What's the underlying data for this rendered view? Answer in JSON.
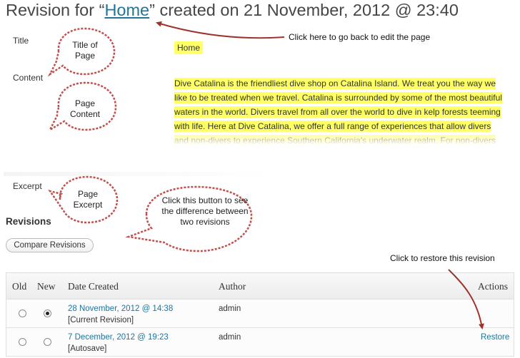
{
  "header": {
    "prefix": "Revision for “",
    "link_text": "Home",
    "suffix": "” created on 21 November, 2012 @ 23:40"
  },
  "fields": {
    "title_label": "Title",
    "title_value": "Home",
    "content_label": "Content",
    "content_value": "Dive Catalina is the friendliest dive shop on Catalina Island. We treat you the way we like to be treated when we travel. Catalina is surrounded by some of the most beautiful waters in the world. Divers travel from all over the world to dive in kelp forests teeming with life. Here at Dive Catalina, we offer a full range of experiences that allow divers and non-divers to experience Southern California's underwater realm. For non-divers",
    "excerpt_label": "Excerpt"
  },
  "revisions": {
    "heading": "Revisions",
    "compare_button": "Compare Revisions",
    "columns": [
      "Old",
      "New",
      "Date Created",
      "Author",
      "Actions"
    ],
    "rows": [
      {
        "date": "28 November, 2012 @ 14:38",
        "note": "[Current Revision]",
        "author": "admin",
        "action": "",
        "old_checked": false,
        "new_checked": true
      },
      {
        "date": "7 December, 2012 @ 19:23",
        "note": "[Autosave]",
        "author": "admin",
        "action": "Restore",
        "old_checked": false,
        "new_checked": false
      }
    ]
  },
  "annotations": {
    "callout_title": "Title of Page",
    "callout_content": "Page Content",
    "callout_excerpt": "Page Excerpt",
    "callout_compare": "Click this button to see the difference between two revisions",
    "note_back": "Click here to go back to edit the page",
    "note_restore": "Click to restore this revision"
  },
  "colors": {
    "highlight": "#ffff66",
    "link": "#21759b",
    "callout_fill": "#ffffff",
    "callout_stroke": "#c0504d",
    "arrow": "#a0322c"
  }
}
